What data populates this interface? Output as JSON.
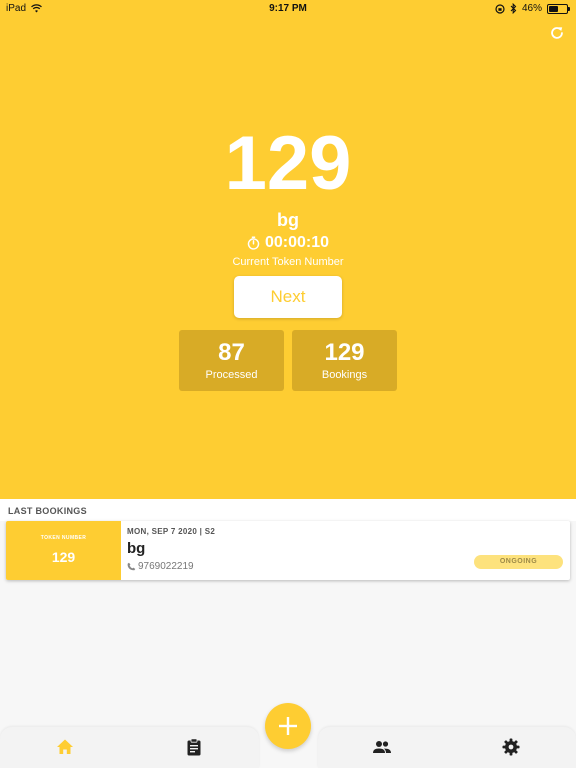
{
  "status_bar": {
    "carrier": "iPad",
    "time": "9:17 PM",
    "battery": "46%",
    "battery_level": 0.46
  },
  "current": {
    "token_number": "129",
    "name": "bg",
    "timer": "00:00:10",
    "caption": "Current Token Number"
  },
  "actions": {
    "next_label": "Next"
  },
  "stats": {
    "processed": {
      "value": "87",
      "label": "Processed"
    },
    "bookings": {
      "value": "129",
      "label": "Bookings"
    }
  },
  "last_bookings": {
    "title": "LAST BOOKINGS",
    "items": [
      {
        "token_label": "TOKEN NUMBER",
        "token": "129",
        "date": "MON, SEP 7 2020 | S2",
        "name": "bg",
        "phone": "9769022219",
        "status": "ONGOING"
      }
    ]
  },
  "tabs": [
    {
      "name": "home",
      "icon": "home-icon"
    },
    {
      "name": "bookings",
      "icon": "clipboard-icon"
    },
    {
      "name": "users",
      "icon": "people-icon"
    },
    {
      "name": "settings",
      "icon": "gear-icon"
    }
  ],
  "colors": {
    "accent": "#fecd32",
    "stat_bg": "#d8ab26",
    "badge_bg": "#fde27d",
    "tab_active": "#fecd32",
    "tab_inactive": "#222222"
  }
}
